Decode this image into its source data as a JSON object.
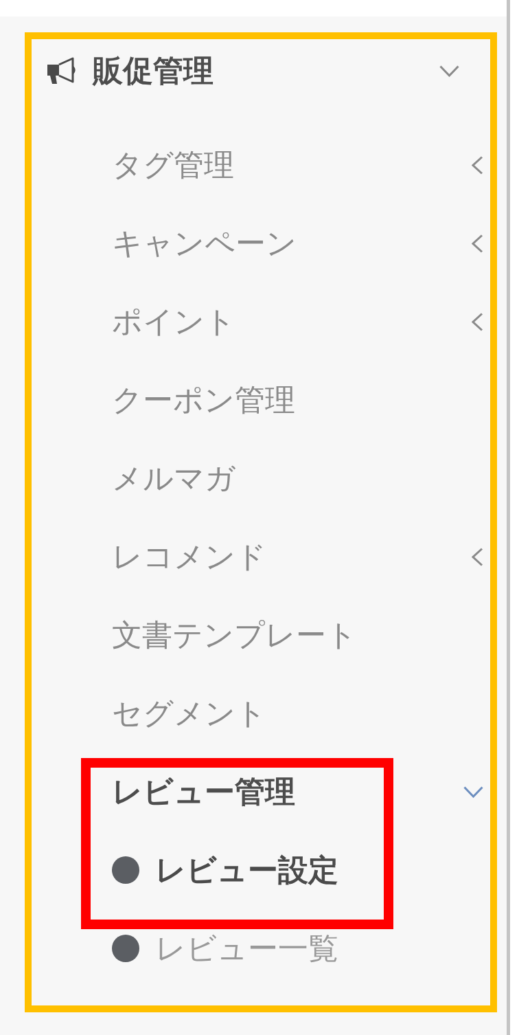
{
  "sidebar": {
    "section": {
      "title": "販促管理",
      "expanded": true,
      "items": [
        {
          "label": "タグ管理",
          "kind": "submenu",
          "expanded": false
        },
        {
          "label": "キャンペーン",
          "kind": "submenu",
          "expanded": false
        },
        {
          "label": "ポイント",
          "kind": "submenu",
          "expanded": false
        },
        {
          "label": "クーポン管理",
          "kind": "link"
        },
        {
          "label": "メルマガ",
          "kind": "link"
        },
        {
          "label": "レコメンド",
          "kind": "submenu",
          "expanded": false
        },
        {
          "label": "文書テンプレート",
          "kind": "link"
        },
        {
          "label": "セグメント",
          "kind": "link"
        },
        {
          "label": "レビュー管理",
          "kind": "submenu",
          "expanded": true,
          "children": [
            {
              "label": "レビュー設定",
              "selected": true
            },
            {
              "label": "レビュー一覧",
              "selected": false
            }
          ]
        }
      ]
    }
  },
  "annotations": [
    {
      "kind": "section_frame",
      "color": "#ffc000"
    },
    {
      "kind": "item_frame",
      "color": "#ff0000"
    }
  ]
}
